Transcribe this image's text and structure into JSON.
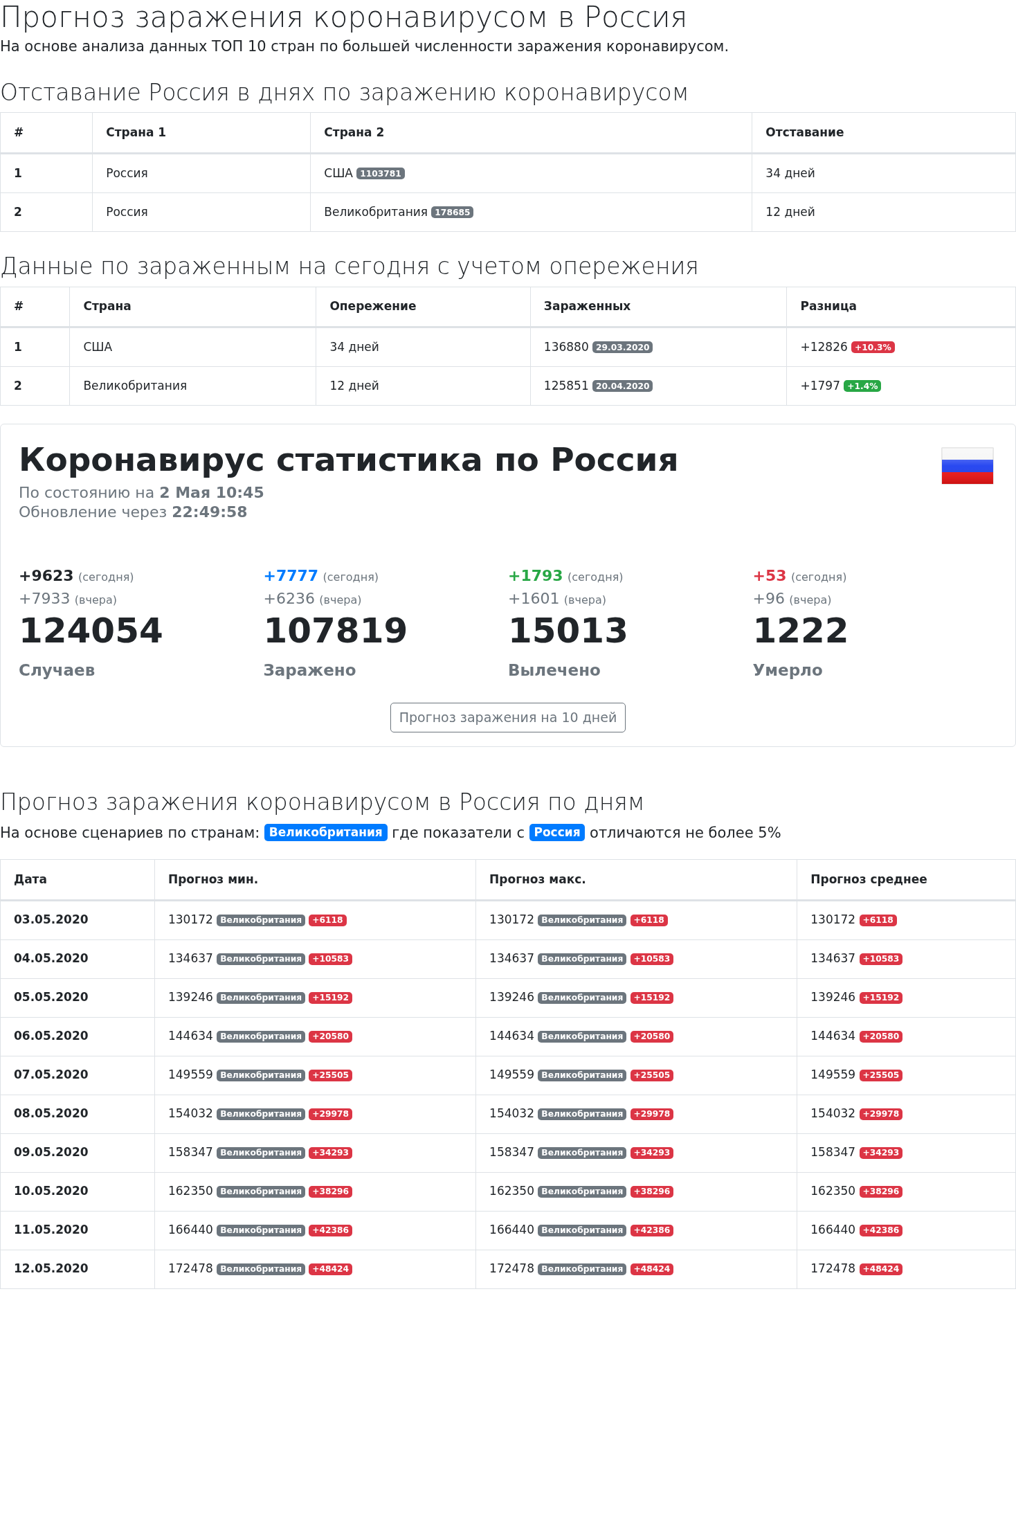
{
  "title": "Прогноз заражения коронавирусом в Россия",
  "subtitle": "На основе анализа данных ТОП 10 стран по большей численности заражения коронавирусом.",
  "lag_section": {
    "heading": "Отставание Россия в днях по заражению коронавирусом",
    "table": {
      "columns": [
        "#",
        "Страна 1",
        "Страна 2",
        "Отставание"
      ],
      "rows": [
        {
          "index": "1",
          "country_1": "Россия",
          "country_2": "США",
          "country_2_badge": "1103781",
          "lag": "34 дней"
        },
        {
          "index": "2",
          "country_1": "Россия",
          "country_2": "Великобритания",
          "country_2_badge": "178685",
          "lag": "12 дней"
        }
      ]
    }
  },
  "lead_section": {
    "heading": "Данные по зараженным на сегодня с учетом опережения",
    "table": {
      "columns": [
        "#",
        "Страна",
        "Опережение",
        "Зараженных",
        "Разница"
      ],
      "rows": [
        {
          "index": "1",
          "country": "США",
          "lead": "34 дней",
          "infected": "136880",
          "date": "29.03.2020",
          "diff": "+12826",
          "diff_badge": "+10.3%",
          "color": "#dc3545"
        },
        {
          "index": "2",
          "country": "Великобритания",
          "lead": "12 дней",
          "infected": "125851",
          "date": "20.04.2020",
          "diff": "+1797",
          "diff_badge": "+1.4%",
          "color": "#28a745"
        }
      ]
    }
  },
  "stats_card": {
    "title": "Коронавирус статистика по Россия",
    "status_prefix": "По состоянию на",
    "status_value": "2 Мая 10:45",
    "update_prefix": "Обновление через",
    "update_value": "22:49:58",
    "stats": [
      {
        "today": "+9623",
        "today_label": "(сегодня)",
        "yesterday": "+7933",
        "yesterday_label": "(вчера)",
        "total": "124054",
        "label": "Случаев",
        "color": "#212529"
      },
      {
        "today": "+7777",
        "today_label": "(сегодня)",
        "yesterday": "+6236",
        "yesterday_label": "(вчера)",
        "total": "107819",
        "label": "Заражено",
        "color": "#007bff"
      },
      {
        "today": "+1793",
        "today_label": "(сегодня)",
        "yesterday": "+1601",
        "yesterday_label": "(вчера)",
        "total": "15013",
        "label": "Вылечено",
        "color": "#28a745"
      },
      {
        "today": "+53",
        "today_label": "(сегодня)",
        "yesterday": "+96",
        "yesterday_label": "(вчера)",
        "total": "1222",
        "label": "Умерло",
        "color": "#dc3545"
      }
    ],
    "button": "Прогноз заражения на 10 дней"
  },
  "forecast_section": {
    "heading": "Прогноз заражения коронавирусом в Россия по дням",
    "note": [
      {
        "kind": "text",
        "text": "На основе сценариев по странам:"
      },
      {
        "kind": "badge",
        "text": "Великобритания"
      },
      {
        "kind": "text",
        "text": "где показатели с"
      },
      {
        "kind": "badge",
        "text": "Россия"
      },
      {
        "kind": "text",
        "text": "отличаются не более 5%"
      }
    ],
    "table": {
      "columns": [
        "Дата",
        "Прогноз мин.",
        "Прогноз макс.",
        "Прогноз среднее"
      ],
      "rows": [
        {
          "date": "03.05.2020",
          "min": "130172",
          "min_country": "Великобритания",
          "min_diff": "+6118",
          "max": "130172",
          "max_country": "Великобритания",
          "max_diff": "+6118",
          "avg": "130172",
          "avg_diff": "+6118"
        },
        {
          "date": "04.05.2020",
          "min": "134637",
          "min_country": "Великобритания",
          "min_diff": "+10583",
          "max": "134637",
          "max_country": "Великобритания",
          "max_diff": "+10583",
          "avg": "134637",
          "avg_diff": "+10583"
        },
        {
          "date": "05.05.2020",
          "min": "139246",
          "min_country": "Великобритания",
          "min_diff": "+15192",
          "max": "139246",
          "max_country": "Великобритания",
          "max_diff": "+15192",
          "avg": "139246",
          "avg_diff": "+15192"
        },
        {
          "date": "06.05.2020",
          "min": "144634",
          "min_country": "Великобритания",
          "min_diff": "+20580",
          "max": "144634",
          "max_country": "Великобритания",
          "max_diff": "+20580",
          "avg": "144634",
          "avg_diff": "+20580"
        },
        {
          "date": "07.05.2020",
          "min": "149559",
          "min_country": "Великобритания",
          "min_diff": "+25505",
          "max": "149559",
          "max_country": "Великобритания",
          "max_diff": "+25505",
          "avg": "149559",
          "avg_diff": "+25505"
        },
        {
          "date": "08.05.2020",
          "min": "154032",
          "min_country": "Великобритания",
          "min_diff": "+29978",
          "max": "154032",
          "max_country": "Великобритания",
          "max_diff": "+29978",
          "avg": "154032",
          "avg_diff": "+29978"
        },
        {
          "date": "09.05.2020",
          "min": "158347",
          "min_country": "Великобритания",
          "min_diff": "+34293",
          "max": "158347",
          "max_country": "Великобритания",
          "max_diff": "+34293",
          "avg": "158347",
          "avg_diff": "+34293"
        },
        {
          "date": "10.05.2020",
          "min": "162350",
          "min_country": "Великобритания",
          "min_diff": "+38296",
          "max": "162350",
          "max_country": "Великобритания",
          "max_diff": "+38296",
          "avg": "162350",
          "avg_diff": "+38296"
        },
        {
          "date": "11.05.2020",
          "min": "166440",
          "min_country": "Великобритания",
          "min_diff": "+42386",
          "max": "166440",
          "max_country": "Великобритания",
          "max_diff": "+42386",
          "avg": "166440",
          "avg_diff": "+42386"
        },
        {
          "date": "12.05.2020",
          "min": "172478",
          "min_country": "Великобритания",
          "min_diff": "+48424",
          "max": "172478",
          "max_country": "Великобритания",
          "max_diff": "+48424",
          "avg": "172478",
          "avg_diff": "+48424"
        }
      ]
    }
  }
}
